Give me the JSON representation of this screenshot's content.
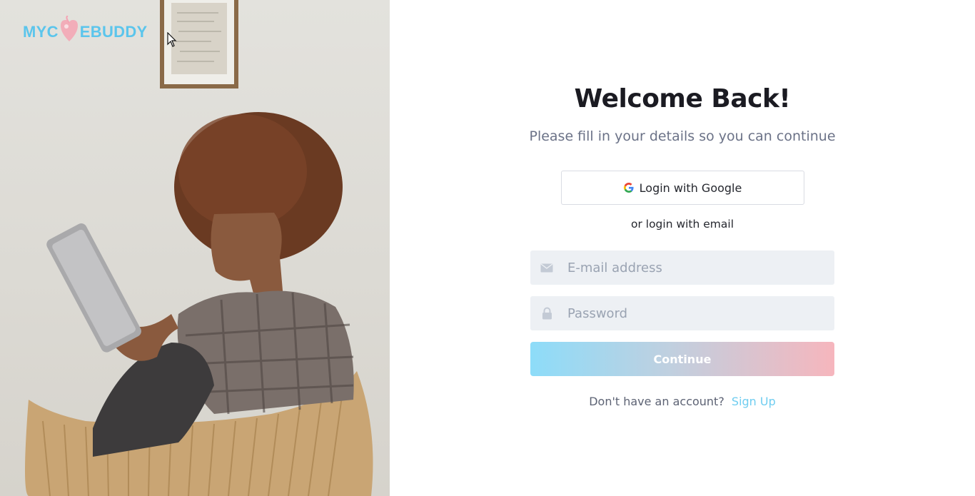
{
  "brand": {
    "logo_text_left": "MYC",
    "logo_text_right": "EBUDDY",
    "accent_color": "#5bc5ec",
    "heart_color": "#f5a3b3"
  },
  "photo": {
    "icon": "person-reading-tablet-photo"
  },
  "form": {
    "title": "Welcome Back!",
    "subtitle": "Please fill in your details so you can continue",
    "google_label": "Login with Google",
    "google_icon": "google-g-icon",
    "or_text": "or login with email",
    "email": {
      "placeholder": "E-mail address",
      "value": "",
      "icon": "envelope-icon"
    },
    "password": {
      "placeholder": "Password",
      "value": "",
      "icon": "lock-icon"
    },
    "continue_label": "Continue",
    "signup_prompt": "Don't have an account?",
    "signup_link": "Sign Up",
    "button_gradient": [
      "#8ddcf9",
      "#f6b6bd"
    ]
  }
}
